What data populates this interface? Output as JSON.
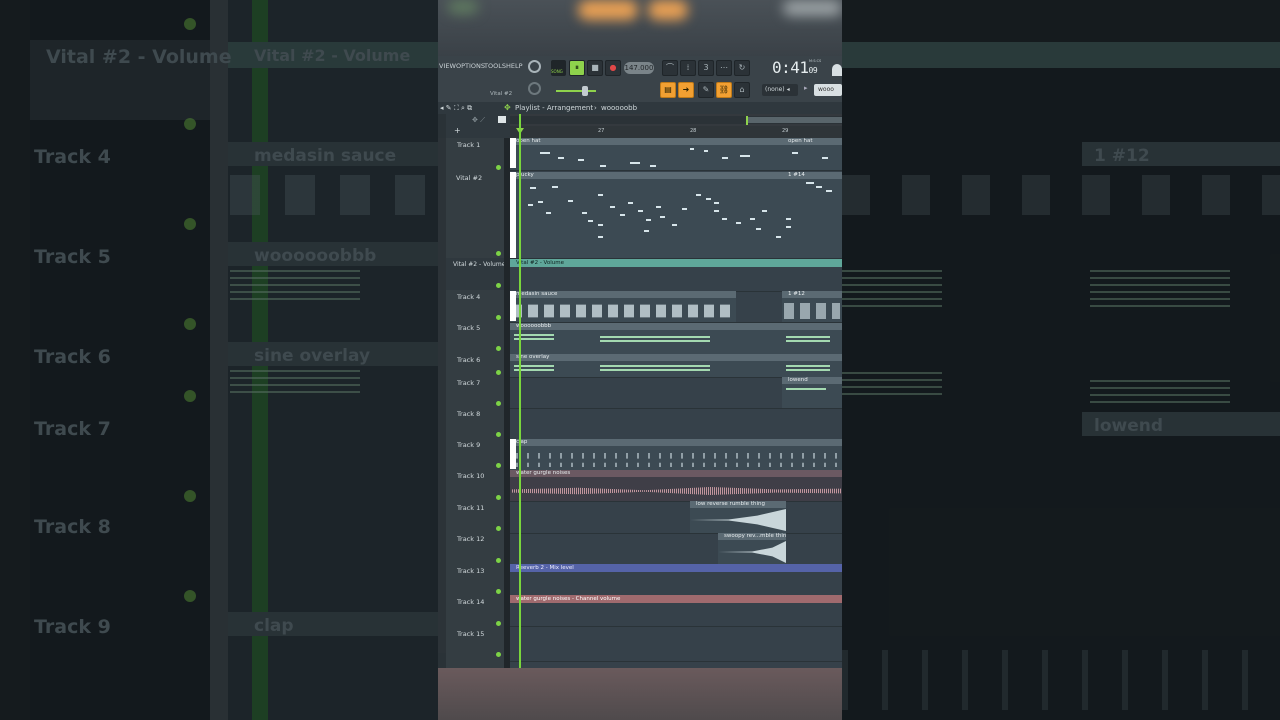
{
  "background": {
    "left_tracks": [
      "Track 4",
      "Track 5",
      "Track 6",
      "Track 7",
      "Track 8",
      "Track 9"
    ],
    "left_auto_label": "Vital #2 - Volume",
    "middle_auto_label": "Vital #2 - Volume",
    "middle_clips": [
      "medasin sauce",
      "woooooobbb",
      "sine overlay",
      "clap"
    ],
    "right_clips": [
      "1 #12",
      "lowend"
    ]
  },
  "menu": [
    "VIEW",
    "OPTIONS",
    "TOOLS",
    "HELP"
  ],
  "transport": {
    "song_label": "SONG",
    "bpm": "147.000",
    "time": "0:41",
    "time_small": "09",
    "time_unit": "M:S:CS"
  },
  "channel": {
    "name": "Vital #2",
    "pattern": "(none)",
    "preset": "wooo"
  },
  "breadcrumb": {
    "title": "Playlist - Arrangement",
    "sep": "›",
    "pattern": "wooooobb"
  },
  "ruler": {
    "marks": [
      "27",
      "28",
      "29"
    ]
  },
  "tracks": [
    {
      "label": "Track 1",
      "clip": "open hat",
      "clip2": "open hat"
    },
    {
      "label": "Vital #2",
      "clip": "plucky",
      "clip2": "1 #14"
    },
    {
      "label": "Vital #2 - Volume",
      "clip": "Vital #2 - Volume"
    },
    {
      "label": "Track 4",
      "clip": "medasin sauce",
      "clip2": "1 #12"
    },
    {
      "label": "Track 5",
      "clip": "woooooobbb"
    },
    {
      "label": "Track 6",
      "clip": "sine overlay"
    },
    {
      "label": "Track 7",
      "clip2": "lowend"
    },
    {
      "label": "Track 8"
    },
    {
      "label": "Track 9",
      "clip": "clap"
    },
    {
      "label": "Track 10",
      "clip": "water gurgle noises"
    },
    {
      "label": "Track 11",
      "clip": "low reverse rumble thing"
    },
    {
      "label": "Track 12",
      "clip": "swoopy rev...mble thing"
    },
    {
      "label": "Track 13",
      "clip": "Reeverb 2 - Mix level"
    },
    {
      "label": "Track 14",
      "clip": "water gurgle noises - Channel volume"
    },
    {
      "label": "Track 15"
    }
  ],
  "colors": {
    "accent": "#f2a032",
    "playhead": "#79d63c",
    "automation": "#5fa79a",
    "audio": "#a06a6e"
  }
}
